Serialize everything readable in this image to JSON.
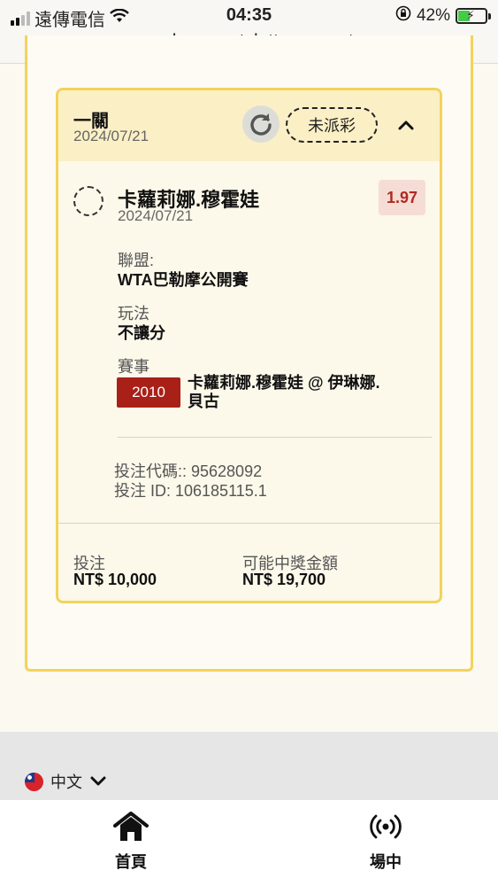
{
  "status_bar": {
    "carrier": "遠傳電信",
    "time": "04:35",
    "battery": "42%",
    "battery_level": 0.42,
    "url": "member.sportslottery.com.tw"
  },
  "bet": {
    "type": "一關",
    "date": "2024/07/21",
    "status": "未派彩",
    "selection": {
      "name": "卡蘿莉娜.穆霍娃",
      "date": "2024/07/21",
      "odds": "1.97"
    },
    "league_label": "聯盟:",
    "league": "WTA巴勒摩公開賽",
    "market_label": "玩法",
    "market": "不讓分",
    "event_label": "賽事",
    "event_code": "2010",
    "event_name": "卡蘿莉娜.穆霍娃 @ 伊琳娜.貝古",
    "bet_code": "投注代碼:: 95628092",
    "bet_id": "投注 ID: 106185115.1",
    "stake_label": "投注",
    "stake": "NT$ 10,000",
    "payout_label": "可能中獎金額",
    "payout": "NT$ 19,700"
  },
  "footer": {
    "language": "中文"
  },
  "nav": {
    "home": "首頁",
    "live": "場中"
  },
  "colors": {
    "accent_yellow": "#f2d35c",
    "header_bg": "#fbefc5",
    "event_badge": "#a82017",
    "odds_text": "#b02a22"
  }
}
